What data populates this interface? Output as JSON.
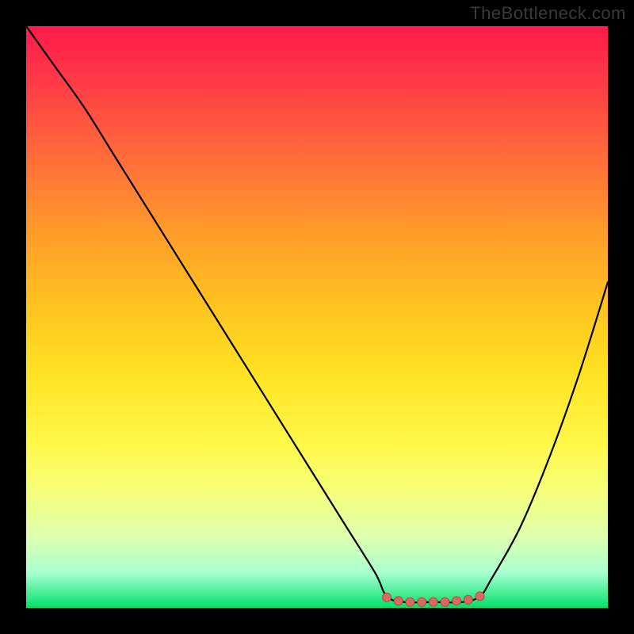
{
  "watermark": "TheBottleneck.com",
  "colors": {
    "frame": "#000000",
    "curve": "#000000",
    "marker_fill": "#da6a5e",
    "marker_stroke": "#b24a40"
  },
  "chart_data": {
    "type": "line",
    "title": "",
    "xlabel": "",
    "ylabel": "",
    "xlim": [
      0,
      100
    ],
    "ylim": [
      0,
      100
    ],
    "grid": false,
    "background": "red-yellow-green vertical gradient (red top, green bottom)",
    "series": [
      {
        "name": "bottleneck-curve",
        "x": [
          0,
          5,
          10,
          15,
          20,
          25,
          30,
          35,
          40,
          45,
          50,
          55,
          60,
          62,
          65,
          70,
          75,
          78,
          80,
          85,
          90,
          95,
          100
        ],
        "y": [
          100,
          93,
          86,
          78,
          70,
          62,
          54,
          46,
          38,
          30,
          22,
          14,
          6,
          2,
          1,
          1,
          1,
          2,
          5,
          14,
          26,
          40,
          56
        ]
      }
    ],
    "markers": {
      "name": "optimal-range",
      "points": [
        {
          "x": 62,
          "y": 1.8
        },
        {
          "x": 64,
          "y": 1.2
        },
        {
          "x": 66,
          "y": 1.0
        },
        {
          "x": 68,
          "y": 1.0
        },
        {
          "x": 70,
          "y": 1.0
        },
        {
          "x": 72,
          "y": 1.0
        },
        {
          "x": 74,
          "y": 1.2
        },
        {
          "x": 76,
          "y": 1.4
        },
        {
          "x": 78,
          "y": 2.0
        }
      ]
    }
  }
}
